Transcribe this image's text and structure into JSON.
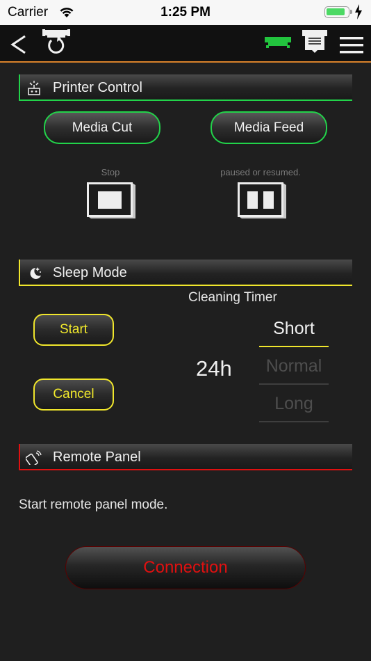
{
  "status_bar": {
    "carrier": "Carrier",
    "time": "1:25 PM",
    "battery_color": "#4cd964"
  },
  "nav": {
    "icons": [
      "back-arrow-icon",
      "printer-refresh-icon",
      "printer-status-icon",
      "printer-download-icon",
      "hamburger-menu-icon"
    ],
    "back_label": "<",
    "bottom_border_color": "#d9822b"
  },
  "printer_control": {
    "title": "Printer Control",
    "accent_color": "#22d34a",
    "media_cut_label": "Media Cut",
    "media_feed_label": "Media Feed",
    "stop_caption": "Stop",
    "pause_caption": "paused or resumed."
  },
  "sleep_mode": {
    "title": "Sleep Mode",
    "accent_color": "#f0e62c",
    "start_label": "Start",
    "cancel_label": "Cancel",
    "cleaning_timer_label": "Cleaning Timer",
    "hours_value": "24h",
    "timer_options": [
      "Short",
      "Normal",
      "Long"
    ],
    "selected_option": "Short"
  },
  "remote_panel": {
    "title": "Remote Panel",
    "accent_color": "#e01010",
    "description": "Start remote panel mode.",
    "connection_label": "Connection"
  }
}
